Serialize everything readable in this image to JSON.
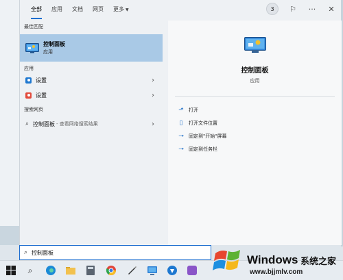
{
  "tabs": [
    {
      "label": "全部"
    },
    {
      "label": "应用"
    },
    {
      "label": "文档"
    },
    {
      "label": "网页"
    },
    {
      "label": "更多"
    }
  ],
  "tab_badge": "3",
  "sections": {
    "best_match": "最佳匹配",
    "apps": "应用",
    "web_search": "搜索网页"
  },
  "best_match": {
    "name": "控制面板",
    "type": "应用"
  },
  "apps": [
    {
      "label": "设置",
      "icon": "settings-icon-blue"
    },
    {
      "label": "设置",
      "icon": "settings-icon-red"
    }
  ],
  "web_result": {
    "label": "控制面板",
    "sub": "- 查看网络搜索结果"
  },
  "preview": {
    "title": "控制面板",
    "subtitle": "应用"
  },
  "actions": [
    {
      "label": "打开",
      "icon": "open-icon"
    },
    {
      "label": "打开文件位置",
      "icon": "folder-open-icon"
    },
    {
      "label": "固定到\"开始\"屏幕",
      "icon": "pin-icon"
    },
    {
      "label": "固定到任务栏",
      "icon": "pin-icon"
    }
  ],
  "search": {
    "value": "控制面板"
  },
  "watermark": {
    "brand": "Windows",
    "cn": "系统之家",
    "url": "www.bjjmlv.com"
  },
  "colors": {
    "accent": "#1f6fd0",
    "selected": "#a9c9e6",
    "panel": "#eef1f4",
    "preview": "#f7f8f9"
  }
}
